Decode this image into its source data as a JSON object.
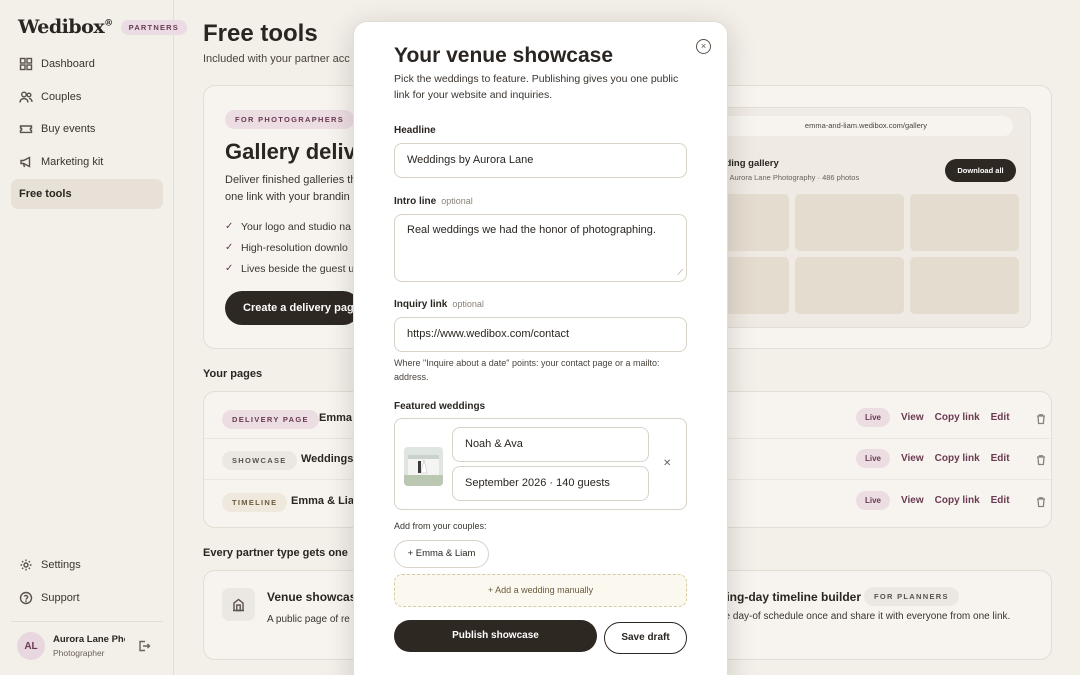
{
  "brand": {
    "logo": "Wedibox",
    "badge": "PARTNERS"
  },
  "sidebar": {
    "items": [
      {
        "label": "Dashboard",
        "icon": "grid-icon"
      },
      {
        "label": "Couples",
        "icon": "users-icon"
      },
      {
        "label": "Buy events",
        "icon": "ticket-icon"
      },
      {
        "label": "Marketing kit",
        "icon": "megaphone-icon"
      },
      {
        "label": "Free tools",
        "icon": "tools-icon"
      }
    ],
    "bottom": [
      {
        "label": "Settings",
        "icon": "gear-icon"
      },
      {
        "label": "Support",
        "icon": "help-icon"
      }
    ],
    "user": {
      "initials": "AL",
      "name": "Aurora Lane Photography",
      "role": "Photographer"
    }
  },
  "page": {
    "title": "Free tools",
    "subtitle": "Included with your partner acc"
  },
  "hero": {
    "pill": "FOR PHOTOGRAPHERS",
    "title": "Gallery deliv",
    "desc": "Deliver finished galleries th one link with your brandin",
    "checks": [
      "Your logo and studio na",
      "High-resolution downlo",
      "Lives beside the guest u"
    ],
    "cta": "Create a delivery page",
    "preview": {
      "url": "emma-and-liam.wedibox.com/gallery",
      "title": "wedding gallery",
      "meta": "red by Aurora Lane Photography · 486 photos",
      "download": "Download all"
    }
  },
  "your_pages": {
    "label": "Your pages",
    "rows": [
      {
        "type": "DELIVERY PAGE",
        "name": "Emma &",
        "status": "Live"
      },
      {
        "type": "SHOWCASE",
        "name": "Weddings",
        "status": "Live"
      },
      {
        "type": "TIMELINE",
        "name": "Emma & Liam",
        "status": "Live"
      }
    ],
    "actions": {
      "view": "View",
      "copy": "Copy link",
      "edit": "Edit"
    }
  },
  "types": {
    "label": "Every partner type gets one",
    "venue": {
      "title": "Venue showcase",
      "desc": "A public page of re share."
    },
    "planner": {
      "title": "ding-day timeline builder",
      "pill": "FOR PLANNERS",
      "desc": "he day-of schedule once and share it with everyone from one link."
    }
  },
  "modal": {
    "title": "Your venue showcase",
    "intro": "Pick the weddings to feature. Publishing gives you one public link for your website and inquiries.",
    "headline": {
      "label": "Headline",
      "value": "Weddings by Aurora Lane"
    },
    "intro_line": {
      "label": "Intro line",
      "optional": "optional",
      "value": "Real weddings we had the honor of photographing."
    },
    "inquiry": {
      "label": "Inquiry link",
      "optional": "optional",
      "value": "https://www.wedibox.com/contact",
      "help": "Where \"Inquire about a date\" points: your contact page or a mailto: address."
    },
    "featured": {
      "label": "Featured weddings",
      "items": [
        {
          "couple": "Noah & Ava",
          "details": "September 2026 · 140 guests"
        }
      ]
    },
    "add_from": "Add from your couples:",
    "couple_chip": "+ Emma & Liam",
    "add_manual": "+ Add a wedding manually",
    "publish": "Publish showcase",
    "save_draft": "Save draft",
    "close_glyph": "×"
  },
  "colors": {
    "accent": "#6a3a52",
    "dark": "#2e2823",
    "background": "#f3efe9"
  }
}
